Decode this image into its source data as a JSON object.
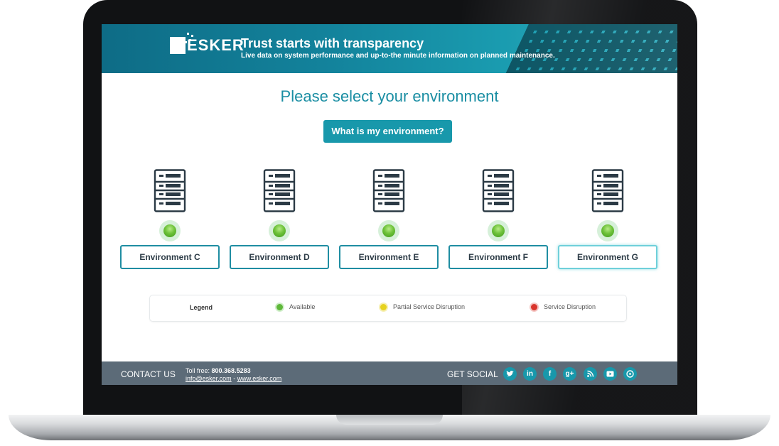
{
  "header": {
    "logo_text": "ESKER",
    "title": "Trust starts with transparency",
    "subtitle": "Live data on system performance and up-to-the minute information on planned maintenance."
  },
  "main": {
    "title": "Please select your environment",
    "help_button": "What is my environment?",
    "environments": [
      {
        "label": "Environment C",
        "status": "available"
      },
      {
        "label": "Environment D",
        "status": "available"
      },
      {
        "label": "Environment E",
        "status": "available"
      },
      {
        "label": "Environment F",
        "status": "available"
      },
      {
        "label": "Environment G",
        "status": "available"
      }
    ]
  },
  "legend": {
    "title": "Legend",
    "items": [
      {
        "label": "Available",
        "color": "#5fb83a"
      },
      {
        "label": "Partial Service Disruption",
        "color": "#e6d21e"
      },
      {
        "label": "Service Disruption",
        "color": "#d9342b"
      }
    ]
  },
  "footer": {
    "contact_label": "CONTACT US",
    "toll_free_label": "Toll free:",
    "phone": "800.368.5283",
    "email": "info@esker.com",
    "separator": "-",
    "website": "www.esker.com",
    "social_label": "GET SOCIAL",
    "social_icons": [
      "twitter-icon",
      "linkedin-icon",
      "facebook-icon",
      "google-plus-icon",
      "rss-icon",
      "youtube-icon",
      "blog-icon"
    ]
  },
  "colors": {
    "accent": "#1898ab",
    "footer_bg": "#5c6b78",
    "title_color": "#1a8ea3"
  }
}
